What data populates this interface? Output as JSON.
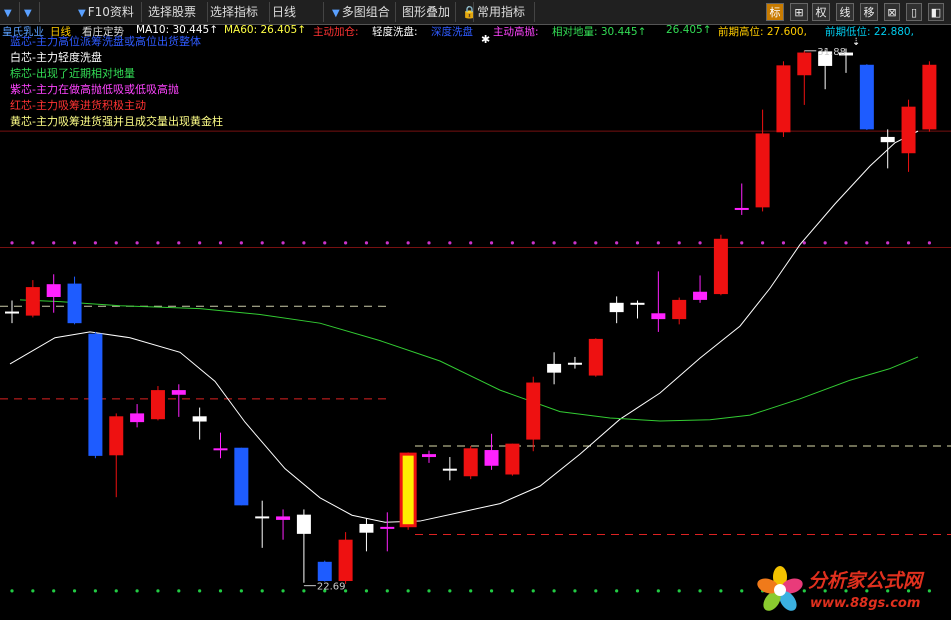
{
  "toolbar": {
    "items": [
      {
        "label": "",
        "arrow": true
      },
      {
        "label": "",
        "arrow": true
      },
      {
        "label": "F10资料",
        "arrow": true
      },
      {
        "label": "选择股票",
        "arrow": false
      },
      {
        "label": "选择指标",
        "arrow": false
      },
      {
        "label": "日线",
        "arrow": false
      },
      {
        "label": "多图组合",
        "arrow": true
      },
      {
        "label": "图形叠加",
        "arrow": false
      },
      {
        "label": "常用指标",
        "arrow": false
      }
    ],
    "icons": [
      "标",
      "⊞",
      "权",
      "线",
      "移",
      "⊠",
      "▯",
      "◧",
      "✕"
    ]
  },
  "info": {
    "stock": "皇氏乳业",
    "period": "日线",
    "indicator": "看庄定势",
    "ma10": "MA10: 30.445↑",
    "ma60": "MA60: 26.405↑",
    "zdjc": "主动加仓:",
    "qdxp": "轻度洗盘:",
    "ydxp": "深度洗盘",
    "zdgp": "主动高抛:",
    "xddl": "相对地量: 30.445↑",
    "v2": "26.405↑",
    "qqgw": "前期高位: 27.600,",
    "qqdw": "前期低位: 22.880,"
  },
  "legend": [
    {
      "text": "蓝芯-主力高位派筹洗盘或高位出货整体",
      "color": "#2f5bff"
    },
    {
      "text": "白芯-主力轻度洗盘",
      "color": "#ffffff"
    },
    {
      "text": "棕芯-出现了近期相对地量",
      "color": "#33dd55"
    },
    {
      "text": "紫芯-主力在做高抛低吸或低吸高抛",
      "color": "#ff44ff"
    },
    {
      "text": "红芯-主力吸筹进货积极主动",
      "color": "#ff3333"
    },
    {
      "text": "黄芯-主力吸筹进货强并且成交量出现黄金柱",
      "color": "#ffff88"
    }
  ],
  "chart_data": {
    "type": "candlestick",
    "y_range": [
      22.1,
      32.1
    ],
    "high_label": "31.88",
    "low_label": "22.69",
    "candles": [
      {
        "o": 27.38,
        "h": 27.59,
        "l": 27.2,
        "c": 27.4,
        "cls": "white"
      },
      {
        "o": 27.33,
        "h": 27.94,
        "l": 27.3,
        "c": 27.82,
        "cls": "red"
      },
      {
        "o": 27.65,
        "h": 28.04,
        "l": 27.38,
        "c": 27.87,
        "cls": "magenta"
      },
      {
        "o": 27.88,
        "h": 28.0,
        "l": 27.18,
        "c": 27.2,
        "cls": "blue"
      },
      {
        "o": 27.02,
        "h": 27.05,
        "l": 24.88,
        "c": 24.92,
        "cls": "blue"
      },
      {
        "o": 24.93,
        "h": 25.65,
        "l": 24.21,
        "c": 25.6,
        "cls": "red"
      },
      {
        "o": 25.5,
        "h": 25.81,
        "l": 25.41,
        "c": 25.65,
        "cls": "magenta"
      },
      {
        "o": 25.55,
        "h": 26.12,
        "l": 25.53,
        "c": 26.05,
        "cls": "red"
      },
      {
        "o": 25.97,
        "h": 26.15,
        "l": 25.59,
        "c": 26.05,
        "cls": "magenta"
      },
      {
        "o": 25.51,
        "h": 25.75,
        "l": 25.2,
        "c": 25.6,
        "cls": "white"
      },
      {
        "o": 25.05,
        "h": 25.32,
        "l": 24.88,
        "c": 25.02,
        "cls": "magenta"
      },
      {
        "o": 25.06,
        "h": 25.06,
        "l": 24.07,
        "c": 24.07,
        "cls": "blue"
      },
      {
        "o": 23.88,
        "h": 24.15,
        "l": 23.34,
        "c": 23.86,
        "cls": "white"
      },
      {
        "o": 23.88,
        "h": 24.0,
        "l": 23.48,
        "c": 23.82,
        "cls": "magenta"
      },
      {
        "o": 23.91,
        "h": 24.0,
        "l": 22.74,
        "c": 23.58,
        "cls": "white"
      },
      {
        "o": 23.1,
        "h": 23.12,
        "l": 22.76,
        "c": 22.77,
        "cls": "blue"
      },
      {
        "o": 22.77,
        "h": 23.61,
        "l": 22.72,
        "c": 23.48,
        "cls": "red"
      },
      {
        "o": 23.6,
        "h": 23.85,
        "l": 23.28,
        "c": 23.75,
        "cls": "white"
      },
      {
        "o": 23.68,
        "h": 23.95,
        "l": 23.28,
        "c": 23.7,
        "cls": "magenta"
      },
      {
        "o": 23.72,
        "h": 24.98,
        "l": 23.65,
        "c": 24.95,
        "cls": "yellow"
      },
      {
        "o": 24.9,
        "h": 25.01,
        "l": 24.8,
        "c": 24.95,
        "cls": "magenta"
      },
      {
        "o": 24.7,
        "h": 24.9,
        "l": 24.5,
        "c": 24.7,
        "cls": "white"
      },
      {
        "o": 24.57,
        "h": 25.09,
        "l": 24.52,
        "c": 25.05,
        "cls": "red"
      },
      {
        "o": 24.75,
        "h": 25.3,
        "l": 24.68,
        "c": 25.02,
        "cls": "magenta"
      },
      {
        "o": 24.6,
        "h": 25.13,
        "l": 24.58,
        "c": 25.13,
        "cls": "red"
      },
      {
        "o": 25.2,
        "h": 26.28,
        "l": 25.0,
        "c": 26.18,
        "cls": "red"
      },
      {
        "o": 26.35,
        "h": 26.7,
        "l": 26.15,
        "c": 26.5,
        "cls": "white"
      },
      {
        "o": 26.52,
        "h": 26.62,
        "l": 26.42,
        "c": 26.52,
        "cls": "white"
      },
      {
        "o": 26.3,
        "h": 26.94,
        "l": 26.28,
        "c": 26.93,
        "cls": "red"
      },
      {
        "o": 27.39,
        "h": 27.66,
        "l": 27.2,
        "c": 27.55,
        "cls": "white"
      },
      {
        "o": 27.52,
        "h": 27.59,
        "l": 27.28,
        "c": 27.55,
        "cls": "white"
      },
      {
        "o": 27.37,
        "h": 28.09,
        "l": 27.05,
        "c": 27.27,
        "cls": "magenta"
      },
      {
        "o": 27.27,
        "h": 27.64,
        "l": 27.18,
        "c": 27.6,
        "cls": "red"
      },
      {
        "o": 27.6,
        "h": 28.02,
        "l": 27.55,
        "c": 27.74,
        "cls": "magenta"
      },
      {
        "o": 27.7,
        "h": 28.72,
        "l": 27.68,
        "c": 28.65,
        "cls": "red"
      },
      {
        "o": 29.18,
        "h": 29.6,
        "l": 29.06,
        "c": 29.15,
        "cls": "magenta"
      },
      {
        "o": 29.19,
        "h": 30.87,
        "l": 29.12,
        "c": 30.46,
        "cls": "red"
      },
      {
        "o": 30.48,
        "h": 31.7,
        "l": 30.4,
        "c": 31.63,
        "cls": "red"
      },
      {
        "o": 31.46,
        "h": 31.88,
        "l": 30.95,
        "c": 31.85,
        "cls": "red"
      },
      {
        "o": 31.87,
        "h": 31.9,
        "l": 31.22,
        "c": 31.62,
        "cls": "white"
      },
      {
        "o": 31.8,
        "h": 31.92,
        "l": 31.5,
        "c": 31.85,
        "cls": "white"
      },
      {
        "o": 31.64,
        "h": 31.65,
        "l": 30.52,
        "c": 30.53,
        "cls": "blue"
      },
      {
        "o": 30.4,
        "h": 30.53,
        "l": 29.86,
        "c": 30.31,
        "cls": "white"
      },
      {
        "o": 30.12,
        "h": 31.04,
        "l": 29.8,
        "c": 30.92,
        "cls": "red"
      },
      {
        "o": 30.53,
        "h": 31.7,
        "l": 30.49,
        "c": 31.64,
        "cls": "red"
      }
    ],
    "ma10": [
      [
        10,
        26.5
      ],
      [
        25,
        26.65
      ],
      [
        55,
        26.95
      ],
      [
        90,
        27.05
      ],
      [
        130,
        26.95
      ],
      [
        180,
        26.7
      ],
      [
        215,
        26.2
      ],
      [
        245,
        25.5
      ],
      [
        285,
        24.7
      ],
      [
        320,
        24.2
      ],
      [
        352,
        23.9
      ],
      [
        385,
        23.78
      ],
      [
        420,
        23.8
      ],
      [
        460,
        23.95
      ],
      [
        500,
        24.1
      ],
      [
        540,
        24.4
      ],
      [
        580,
        24.95
      ],
      [
        620,
        25.55
      ],
      [
        660,
        26.0
      ],
      [
        700,
        26.6
      ],
      [
        740,
        27.15
      ],
      [
        770,
        27.8
      ],
      [
        800,
        28.55
      ],
      [
        835,
        29.25
      ],
      [
        870,
        29.9
      ],
      [
        895,
        30.3
      ],
      [
        918,
        30.5
      ]
    ],
    "ma60": [
      [
        20,
        27.6
      ],
      [
        60,
        27.57
      ],
      [
        120,
        27.5
      ],
      [
        200,
        27.45
      ],
      [
        260,
        27.35
      ],
      [
        320,
        27.2
      ],
      [
        380,
        26.9
      ],
      [
        440,
        26.55
      ],
      [
        500,
        26.05
      ],
      [
        560,
        25.68
      ],
      [
        610,
        25.57
      ],
      [
        660,
        25.52
      ],
      [
        710,
        25.54
      ],
      [
        750,
        25.62
      ],
      [
        800,
        25.9
      ],
      [
        850,
        26.22
      ],
      [
        890,
        26.42
      ],
      [
        918,
        26.62
      ]
    ],
    "h_lines": [
      {
        "y": 27.49,
        "x1": 0,
        "x2": 390,
        "color": "#ccccaa",
        "dash": true
      },
      {
        "y": 25.9,
        "x1": 0,
        "x2": 390,
        "color": "#dd2222",
        "dash": true
      },
      {
        "y": 25.09,
        "x1": 415,
        "x2": 951,
        "color": "#ddddaa",
        "dash": true
      },
      {
        "y": 23.57,
        "x1": 415,
        "x2": 951,
        "color": "#dd2222",
        "dash": true
      },
      {
        "y": 28.5,
        "x1": 0,
        "x2": 951,
        "color": "#771111",
        "dash": false
      },
      {
        "y": 30.5,
        "x1": 0,
        "x2": 951,
        "color": "#771111",
        "dash": false
      }
    ],
    "dot_rows": [
      {
        "y": 28.58,
        "color": "#cc33cc"
      },
      {
        "y": 22.6,
        "color": "#22cc44"
      }
    ]
  },
  "watermark": {
    "title": "分析家公式网",
    "url": "www.88gs.com"
  }
}
